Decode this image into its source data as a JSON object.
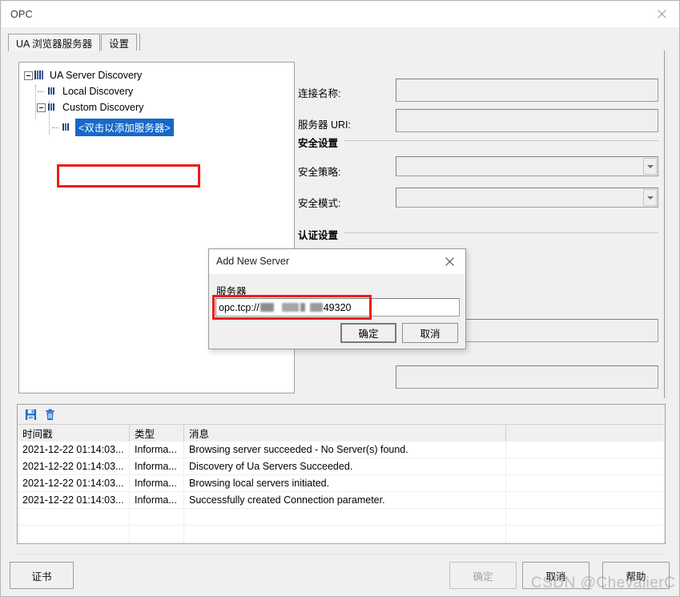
{
  "window": {
    "title": "OPC",
    "close_icon": "close-icon"
  },
  "tabs": [
    {
      "label": "UA 浏览器服务器",
      "active": true
    },
    {
      "label": "设置",
      "active": false
    }
  ],
  "tree": {
    "nodes": [
      {
        "label": "UA Server Discovery",
        "level": 0,
        "expander": "minus",
        "icon": "server-group-icon"
      },
      {
        "label": "Local Discovery",
        "level": 1,
        "expander": "none",
        "icon": "server-icon"
      },
      {
        "label": "Custom Discovery",
        "level": 1,
        "expander": "minus",
        "icon": "server-icon"
      },
      {
        "label": "<双击以添加服务器>",
        "level": 2,
        "expander": "none",
        "icon": "server-icon",
        "selected": true
      }
    ]
  },
  "form": {
    "connection_name_label": "连接名称:",
    "connection_name_value": "",
    "server_uri_label": "服务器 URI:",
    "server_uri_value": "",
    "security_group_label": "安全设置",
    "security_policy_label": "安全策略:",
    "security_policy_value": "",
    "security_mode_label": "安全模式:",
    "security_mode_value": "",
    "auth_group_label": "认证设置",
    "auth_field1_value": "",
    "auth_field2_value": ""
  },
  "dialog": {
    "title": "Add New Server",
    "close_icon": "close-icon",
    "field_label": "服务器",
    "input_prefix": "opc.tcp://",
    "input_suffix": "49320",
    "ok_label": "确定",
    "cancel_label": "取消"
  },
  "log": {
    "toolbar": {
      "save_icon": "save-icon",
      "delete_icon": "trash-icon"
    },
    "columns": [
      "时间戳",
      "类型",
      "消息",
      ""
    ],
    "rows": [
      {
        "timestamp": "2021-12-22 01:14:03...",
        "type": "Informa...",
        "message": "Browsing server succeeded - No Server(s) found.",
        "extra": ""
      },
      {
        "timestamp": "2021-12-22 01:14:03...",
        "type": "Informa...",
        "message": "Discovery of Ua Servers Succeeded.",
        "extra": ""
      },
      {
        "timestamp": "2021-12-22 01:14:03...",
        "type": "Informa...",
        "message": "Browsing local servers initiated.",
        "extra": ""
      },
      {
        "timestamp": "2021-12-22 01:14:03...",
        "type": "Informa...",
        "message": "Successfully created Connection parameter.",
        "extra": ""
      },
      {
        "timestamp": "",
        "type": "",
        "message": "",
        "extra": ""
      },
      {
        "timestamp": "",
        "type": "",
        "message": "",
        "extra": ""
      },
      {
        "timestamp": "",
        "type": "",
        "message": "",
        "extra": ""
      }
    ]
  },
  "footer": {
    "certificate_label": "证书",
    "ok_label": "确定",
    "cancel_label": "取消",
    "help_label": "帮助"
  },
  "watermark": {
    "text": "CSDN @ChevalierC"
  },
  "colors": {
    "selection_blue": "#1669c8",
    "annotation_red": "#ee1b18",
    "icon_blue": "#3a5fa8",
    "window_bg": "#f0f0f0"
  }
}
